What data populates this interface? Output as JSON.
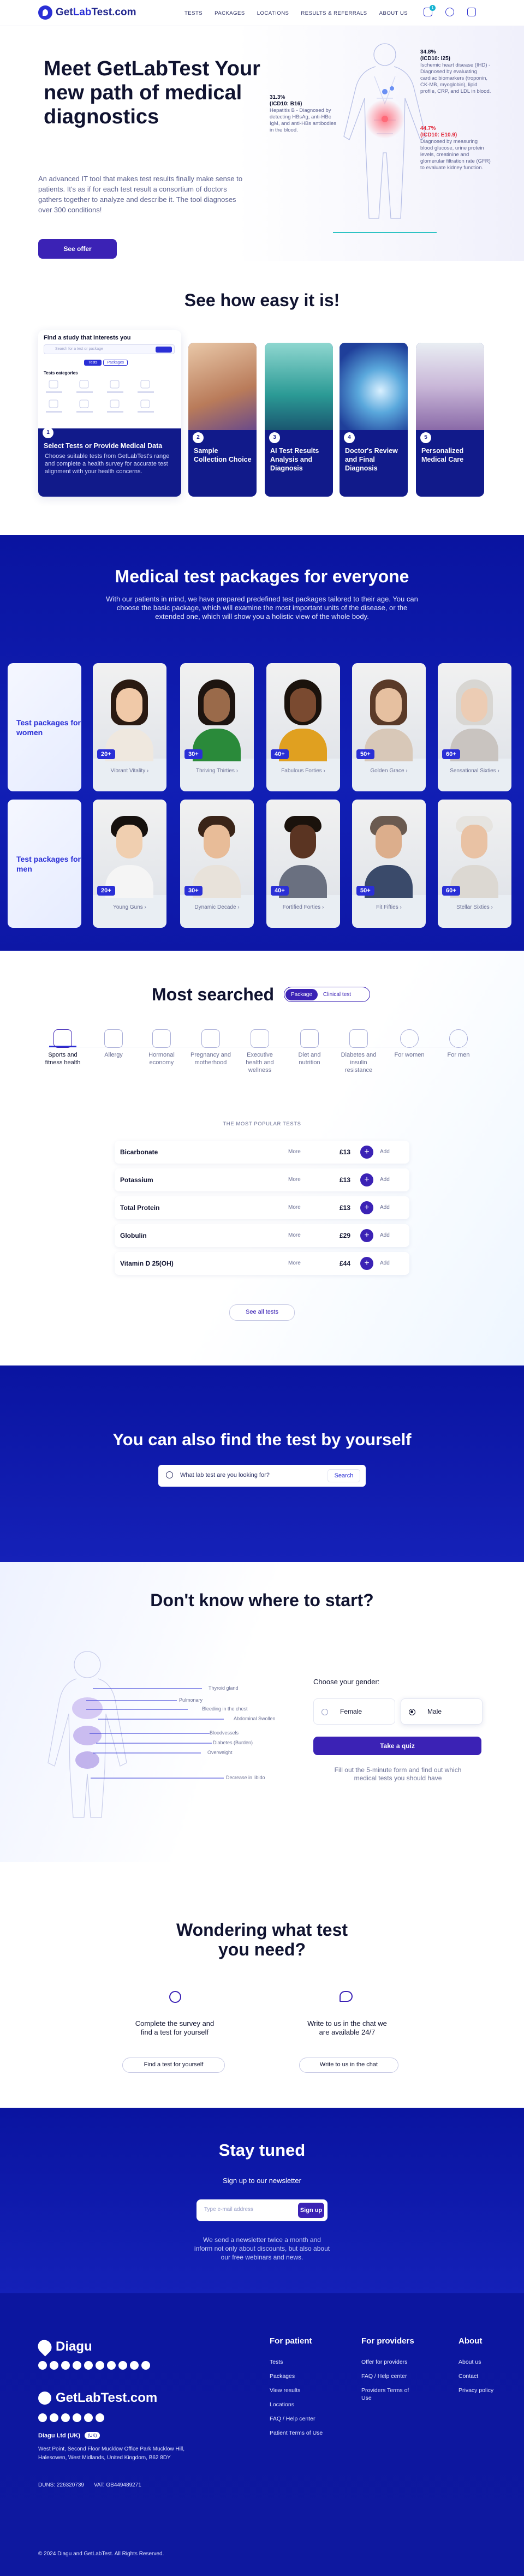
{
  "header": {
    "logo": "GetLabTest.com",
    "logo_a": "Get",
    "logo_b": "Lab",
    "logo_c": "Test.com",
    "nav": [
      "TESTS",
      "PACKAGES",
      "LOCATIONS",
      "RESULTS & REFERRALS",
      "ABOUT US"
    ],
    "cart_count": "1"
  },
  "hero": {
    "title": "Meet GetLabTest Your new path of medical diagnostics",
    "text": "An advanced IT tool that makes test results finally make sense to patients. It's as if for each test result a consortium of doctors gathers together to analyze and describe it. The tool diagnoses over 300 conditions!",
    "cta": "See offer",
    "ann_left": {
      "pct": "31.3%",
      "code": "(ICD10: B16)",
      "desc": "Hepatitis B - Diagnosed by detecting HBsAg, anti-HBc IgM, and anti-HBs antibodies in the blood."
    },
    "ann_right_top": {
      "pct": "34.8%",
      "code": "(ICD10: I25)",
      "desc": "Ischemic heart disease (IHD) - Diagnosed by evaluating cardiac biomarkers (troponin, CK-MB, myoglobin), lipid profile, CRP, and LDL in blood."
    },
    "ann_right_bottom": {
      "pct": "44.7%",
      "code": "(ICD10: E10.9)",
      "desc": "Diagnosed by measuring blood glucose, urine protein levels, creatinine and glomerular filtration rate (GFR) to evaluate kidney function."
    }
  },
  "steps": {
    "title": "See how easy it is!",
    "find_title": "Find a study that interests you",
    "search_placeholder": "Search for a test or package",
    "tabs": [
      "Tests",
      "Packages"
    ],
    "categories_label": "Tests categories",
    "cards": [
      {
        "num": "1",
        "label": "Select Tests or Provide Medical Data",
        "desc": "Choose suitable tests from GetLabTest's range and complete a health survey for accurate test alignment with your health concerns."
      },
      {
        "num": "2",
        "label": "Sample Collection Choice"
      },
      {
        "num": "3",
        "label": "AI Test Results Analysis and Diagnosis"
      },
      {
        "num": "4",
        "label": "Doctor's Review and Final Diagnosis"
      },
      {
        "num": "5",
        "label": "Personalized Medical Care"
      }
    ]
  },
  "packages": {
    "title": "Medical test packages for everyone",
    "subtitle": "With our patients in mind, we have prepared predefined test packages tailored to their age. You can choose the basic package, which will examine the most important units of the disease, or the extended one, which will show you a holistic view of the whole body.",
    "women_label": "Test packages for women",
    "men_label": "Test packages for men",
    "women": [
      {
        "age": "20+",
        "name": "Vibrant Vitality"
      },
      {
        "age": "30+",
        "name": "Thriving Thirties"
      },
      {
        "age": "40+",
        "name": "Fabulous Forties"
      },
      {
        "age": "50+",
        "name": "Golden Grace"
      },
      {
        "age": "60+",
        "name": "Sensational Sixties"
      }
    ],
    "men": [
      {
        "age": "20+",
        "name": "Young Guns"
      },
      {
        "age": "30+",
        "name": "Dynamic Decade"
      },
      {
        "age": "40+",
        "name": "Fortified Forties"
      },
      {
        "age": "50+",
        "name": "Fit Fifties"
      },
      {
        "age": "60+",
        "name": "Stellar Sixties"
      }
    ]
  },
  "most": {
    "title": "Most searched",
    "toggle": [
      "Package",
      "Clinical test"
    ],
    "categories": [
      "Sports and fitness health",
      "Allergy",
      "Hormonal economy",
      "Pregnancy and motherhood",
      "Executive health and wellness",
      "Diet and nutrition",
      "Diabetes and insulin resistance",
      "For women",
      "For men"
    ],
    "popular": "THE MOST POPULAR TESTS",
    "more": "More",
    "add": "Add",
    "tests": [
      {
        "name": "Bicarbonate",
        "price": "£13"
      },
      {
        "name": "Potassium",
        "price": "£13"
      },
      {
        "name": "Total Protein",
        "price": "£13"
      },
      {
        "name": "Globulin",
        "price": "£29"
      },
      {
        "name": "Vitamin D 25(OH)",
        "price": "£44"
      }
    ],
    "see_all": "See all tests"
  },
  "find": {
    "title": "You can also find the test by yourself",
    "placeholder": "What lab test are you looking for?",
    "button": "Search"
  },
  "start": {
    "title": "Don't know where to start?",
    "choose": "Choose your gender:",
    "female": "Female",
    "male": "Male",
    "quiz": "Take a quiz",
    "note": "Fill out the 5-minute form and find out which medical tests you should have",
    "organs": [
      "Thyroid gland",
      "Pulmonary",
      "Bleeding in the chest",
      "Abdominal Swollen",
      "Bloodvessels",
      "Diabetes (Burden)",
      "Overweight",
      "Decrease in libido"
    ]
  },
  "wonder": {
    "title": "Wondering what test you need?",
    "left_text": "Complete the survey and find a test for yourself",
    "left_btn": "Find a test for yourself",
    "right_text": "Write to us in the chat we are available 24/7",
    "right_btn": "Write to us in the chat"
  },
  "tuned": {
    "title": "Stay tuned",
    "sub": "Sign up to our newsletter",
    "placeholder": "Type e-mail address",
    "btn": "Sign up",
    "text": "We send a newsletter twice a month and inform not only about discounts, but also about our free webinars and news."
  },
  "footer": {
    "brand1": "Diagu",
    "brand2": "GetLabTest.com",
    "company": "Diagu Ltd (UK)",
    "company_tag": "(UK)",
    "address": "West Point, Second Floor Mucklow Office Park Mucklow Hill, Halesowen, West Midlands, United Kingdom, B62 8DY",
    "duns": "DUNS: 226320739",
    "vat": "VAT: GB449489271",
    "col_patient": {
      "h": "For patient",
      "links": [
        "Tests",
        "Packages",
        "View results",
        "Locations",
        "FAQ / Help center",
        "Patient Terms of Use"
      ]
    },
    "col_providers": {
      "h": "For providers",
      "links": [
        "Offer for providers",
        "FAQ / Help center",
        "Providers Terms of Use"
      ]
    },
    "col_about": {
      "h": "About",
      "links": [
        "About us",
        "Contact",
        "Privacy policy"
      ]
    },
    "copyright": "© 2024 Diagu and GetLabTest. All Rights Reserved."
  },
  "colors": {
    "primary": "#2a2fd6",
    "deep": "#0a14a0",
    "accent": "#3b22b5"
  }
}
